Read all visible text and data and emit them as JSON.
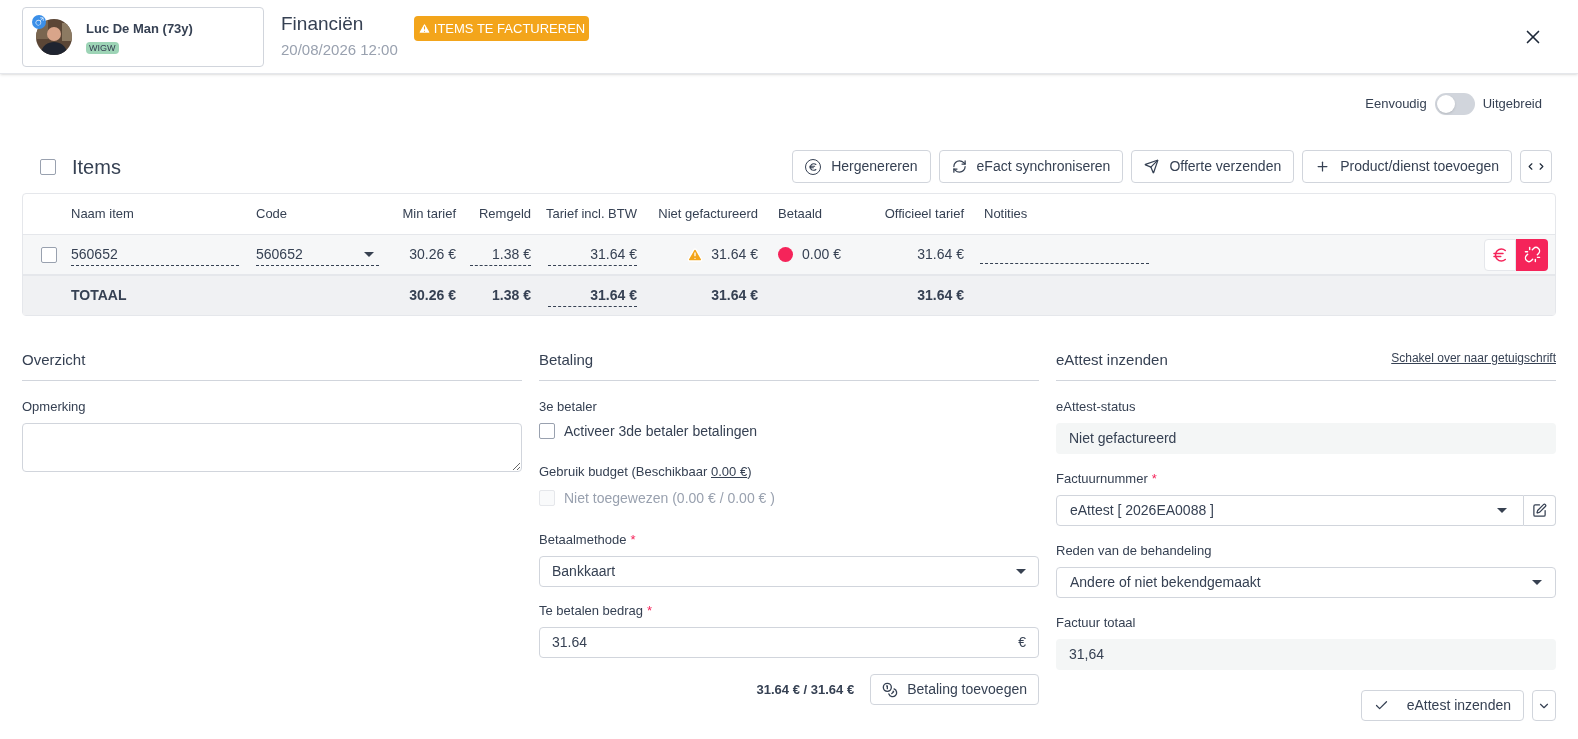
{
  "patient": {
    "name": "Luc De Man (73y)",
    "tag": "WIGW"
  },
  "header": {
    "title": "Financiën",
    "datetime": "20/08/2026 12:00",
    "badge": "ITEMS TE FACTUREREN"
  },
  "view_toggle": {
    "left_label": "Eenvoudig",
    "right_label": "Uitgebreid",
    "on": false
  },
  "items": {
    "title": "Items",
    "select_all_checked": false,
    "actions": [
      {
        "kind": "regenerate",
        "label": "Hergenereren"
      },
      {
        "kind": "sync",
        "label": "eFact synchroniseren"
      },
      {
        "kind": "send",
        "label": "Offerte verzenden"
      },
      {
        "kind": "add",
        "label": "Product/dienst toevoegen"
      }
    ],
    "columns": [
      "Naam item",
      "Code",
      "Min tarief",
      "Remgeld",
      "Tarief incl. BTW",
      "Niet gefactureerd",
      "Betaald",
      "Officieel tarief",
      "Notities"
    ],
    "rows": [
      {
        "checked": false,
        "name": "560652",
        "code": "560652",
        "min_tarief": "30.26 €",
        "remgeld": "1.38 €",
        "tarief": "31.64 €",
        "niet_gefactureerd": "31.64 €",
        "warning": true,
        "betaald": "0.00 €",
        "color": "#f5245a",
        "officieel": "31.64 €"
      }
    ],
    "totals": {
      "label": "TOTAAL",
      "min_tarief": "30.26 €",
      "remgeld": "1.38 €",
      "tarief": "31.64 €",
      "niet_gefactureerd": "31.64 €",
      "officieel": "31.64 €"
    }
  },
  "overview": {
    "title": "Overzicht",
    "remark_label": "Opmerking"
  },
  "payment": {
    "title": "Betaling",
    "third_payer_label": "3e betaler",
    "third_payer_checkbox": {
      "label": "Activeer 3de betaler betalingen",
      "checked": false,
      "disabled": false
    },
    "budget_text": "Gebruik budget (Beschikbaar",
    "budget_link": "0.00 €",
    "budget_close": ")",
    "budget_checkbox": {
      "label": "Niet toegewezen (0.00 € / 0.00 € )",
      "checked": false,
      "disabled": true
    },
    "method": {
      "label": "Betaalmethode",
      "required_mark": "*",
      "value": "Bankkaart"
    },
    "amount": {
      "label": "Te betalen bedrag",
      "required_mark": "*",
      "value": "31.64",
      "suffix": "€"
    },
    "summary": "31.64 € / 31.64 €",
    "add_button": "Betaling toevoegen"
  },
  "eattest": {
    "title": "eAttest inzenden",
    "switch_link": "Schakel over naar getuigschrift",
    "status": {
      "label": "eAttest-status",
      "value": "Niet gefactureerd"
    },
    "invoice_number": {
      "label": "Factuurnummer",
      "required_mark": "*",
      "value": "eAttest [ 2026EA0088 ]"
    },
    "reason": {
      "label": "Reden van de behandeling",
      "value": "Andere of niet bekendgemaakt"
    },
    "total": {
      "label": "Factuur totaal",
      "value": "31,64"
    },
    "submit_button": "eAttest inzenden"
  }
}
